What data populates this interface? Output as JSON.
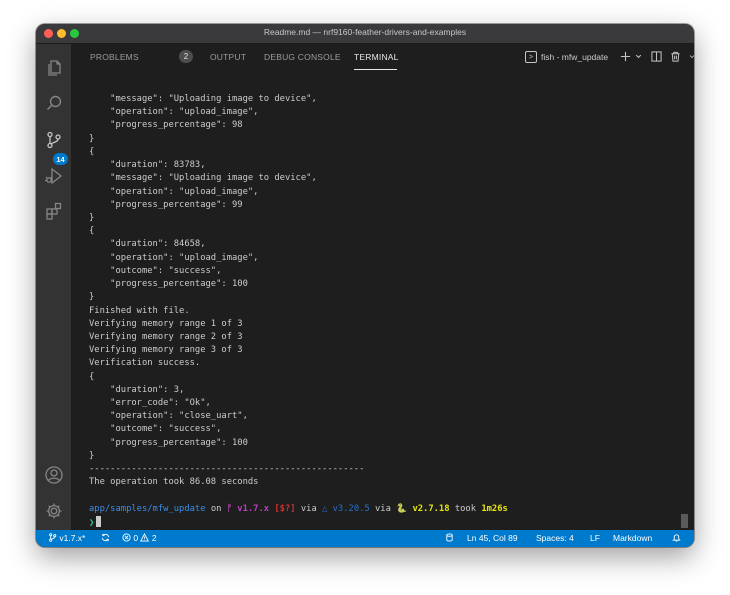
{
  "window": {
    "title": "Readme.md — nrf9160-feather-drivers-and-examples"
  },
  "activity_bar": {
    "items": [
      {
        "name": "explorer",
        "icon": "files-icon"
      },
      {
        "name": "search",
        "icon": "search-icon"
      },
      {
        "name": "source-control",
        "icon": "source-control-icon",
        "badge": "14"
      },
      {
        "name": "run-debug",
        "icon": "run-debug-icon"
      },
      {
        "name": "extensions",
        "icon": "extensions-icon"
      }
    ],
    "bottom": [
      {
        "name": "accounts",
        "icon": "account-icon"
      },
      {
        "name": "manage",
        "icon": "gear-icon"
      }
    ]
  },
  "panel": {
    "tabs": [
      {
        "label": "PROBLEMS",
        "badge": "2"
      },
      {
        "label": "OUTPUT"
      },
      {
        "label": "DEBUG CONSOLE"
      },
      {
        "label": "TERMINAL",
        "active": true
      }
    ],
    "terminal_selector": "fish - mfw_update",
    "actions": [
      "new-terminal-icon",
      "chevron-down-icon",
      "split-terminal-icon",
      "trash-icon",
      "chevron-down-icon",
      "close-icon"
    ]
  },
  "terminal": {
    "lines": [
      "    \"message\": \"Uploading image to device\",",
      "    \"operation\": \"upload_image\",",
      "    \"progress_percentage\": 98",
      "}",
      "{",
      "    \"duration\": 83783,",
      "    \"message\": \"Uploading image to device\",",
      "    \"operation\": \"upload_image\",",
      "    \"progress_percentage\": 99",
      "}",
      "{",
      "    \"duration\": 84658,",
      "    \"operation\": \"upload_image\",",
      "    \"outcome\": \"success\",",
      "    \"progress_percentage\": 100",
      "}",
      "Finished with file.",
      "Verifying memory range 1 of 3",
      "Verifying memory range 2 of 3",
      "Verifying memory range 3 of 3",
      "Verification success.",
      "{",
      "    \"duration\": 3,",
      "    \"error_code\": \"Ok\",",
      "    \"operation\": \"close_uart\",",
      "    \"outcome\": \"success\",",
      "    \"progress_percentage\": 100",
      "}",
      "----------------------------------------------------",
      "The operation took 86.08 seconds",
      ""
    ],
    "prompt": {
      "path": "app/samples/mfw_update",
      "on": " on ",
      "branch": "ᚠ v1.7.x",
      "status": " [$?]",
      "via1": " via ",
      "cmake": "△ v3.20.5",
      "via2": " via ",
      "python": "🐍 v2.7.18",
      "took_label": " took ",
      "took": "1m26s",
      "symbol": "❯"
    }
  },
  "status_bar": {
    "branch": "v1.7.x*",
    "errors": "0",
    "warnings": "2",
    "position": "Ln 45, Col 89",
    "spaces": "Spaces: 4",
    "eol": "LF",
    "language": "Markdown"
  },
  "colors": {
    "accent": "#007acc",
    "background": "#1e1e1e",
    "activity_bar": "#333333",
    "path": "#3b8eea",
    "branch": "#bc3fbc",
    "prompt": "#23d18b"
  }
}
